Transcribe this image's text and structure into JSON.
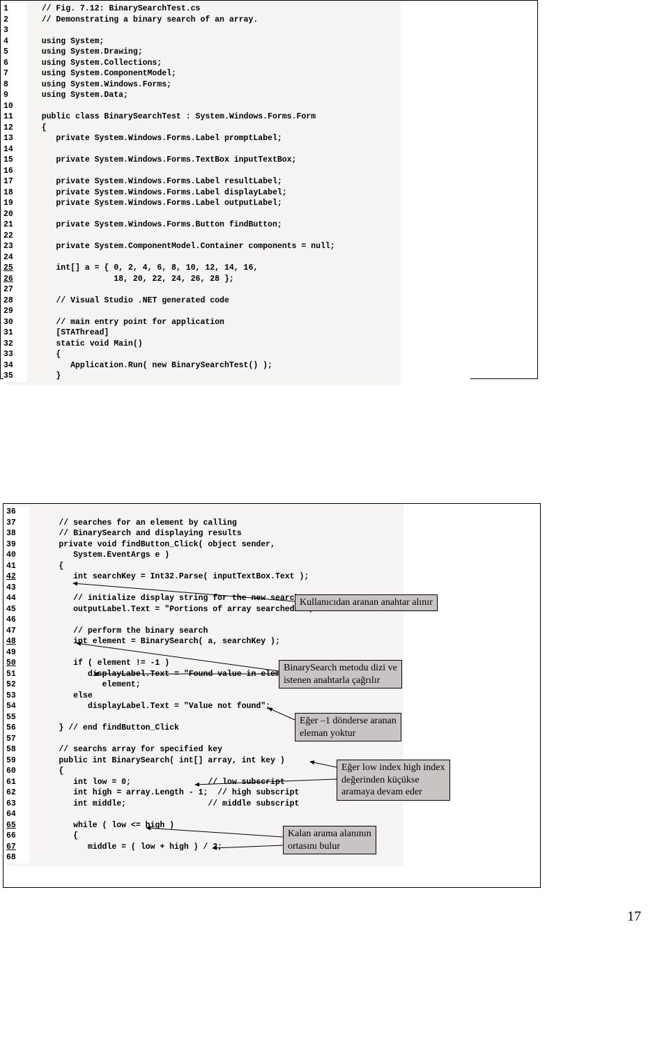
{
  "page_number": "17",
  "box1": {
    "lines": [
      {
        "n": "1",
        "u": false,
        "t": "// Fig. 7.12: BinarySearchTest.cs"
      },
      {
        "n": "2",
        "u": false,
        "t": "// Demonstrating a binary search of an array."
      },
      {
        "n": "3",
        "u": false,
        "t": ""
      },
      {
        "n": "4",
        "u": false,
        "t": "using System;"
      },
      {
        "n": "5",
        "u": false,
        "t": "using System.Drawing;"
      },
      {
        "n": "6",
        "u": false,
        "t": "using System.Collections;"
      },
      {
        "n": "7",
        "u": false,
        "t": "using System.ComponentModel;"
      },
      {
        "n": "8",
        "u": false,
        "t": "using System.Windows.Forms;"
      },
      {
        "n": "9",
        "u": false,
        "t": "using System.Data;"
      },
      {
        "n": "10",
        "u": false,
        "t": ""
      },
      {
        "n": "11",
        "u": false,
        "t": "public class BinarySearchTest : System.Windows.Forms.Form"
      },
      {
        "n": "12",
        "u": false,
        "t": "{"
      },
      {
        "n": "13",
        "u": false,
        "t": "   private System.Windows.Forms.Label promptLabel;"
      },
      {
        "n": "14",
        "u": false,
        "t": ""
      },
      {
        "n": "15",
        "u": false,
        "t": "   private System.Windows.Forms.TextBox inputTextBox;"
      },
      {
        "n": "16",
        "u": false,
        "t": ""
      },
      {
        "n": "17",
        "u": false,
        "t": "   private System.Windows.Forms.Label resultLabel;"
      },
      {
        "n": "18",
        "u": false,
        "t": "   private System.Windows.Forms.Label displayLabel;"
      },
      {
        "n": "19",
        "u": false,
        "t": "   private System.Windows.Forms.Label outputLabel;"
      },
      {
        "n": "20",
        "u": false,
        "t": ""
      },
      {
        "n": "21",
        "u": false,
        "t": "   private System.Windows.Forms.Button findButton;"
      },
      {
        "n": "22",
        "u": false,
        "t": ""
      },
      {
        "n": "23",
        "u": false,
        "t": "   private System.ComponentModel.Container components = null;"
      },
      {
        "n": "24",
        "u": false,
        "t": ""
      },
      {
        "n": "25",
        "u": true,
        "t": "   int[] a = { 0, 2, 4, 6, 8, 10, 12, 14, 16,"
      },
      {
        "n": "26",
        "u": true,
        "t": "               18, 20, 22, 24, 26, 28 };"
      },
      {
        "n": "27",
        "u": false,
        "t": ""
      },
      {
        "n": "28",
        "u": false,
        "t": "   // Visual Studio .NET generated code"
      },
      {
        "n": "29",
        "u": false,
        "t": ""
      },
      {
        "n": "30",
        "u": false,
        "t": "   // main entry point for application"
      },
      {
        "n": "31",
        "u": false,
        "t": "   [STAThread]"
      },
      {
        "n": "32",
        "u": false,
        "t": "   static void Main()"
      },
      {
        "n": "33",
        "u": false,
        "t": "   {"
      },
      {
        "n": "34",
        "u": false,
        "t": "      Application.Run( new BinarySearchTest() );"
      },
      {
        "n": "35",
        "u": false,
        "t": "   }"
      }
    ]
  },
  "box2": {
    "lines": [
      {
        "n": "36",
        "u": false,
        "t": ""
      },
      {
        "n": "37",
        "u": false,
        "t": "   // searches for an element by calling"
      },
      {
        "n": "38",
        "u": false,
        "t": "   // BinarySearch and displaying results"
      },
      {
        "n": "39",
        "u": false,
        "t": "   private void findButton_Click( object sender,"
      },
      {
        "n": "40",
        "u": false,
        "t": "      System.EventArgs e )"
      },
      {
        "n": "41",
        "u": false,
        "t": "   {"
      },
      {
        "n": "42",
        "u": true,
        "t": "      int searchKey = Int32.Parse( inputTextBox.Text );"
      },
      {
        "n": "43",
        "u": false,
        "t": ""
      },
      {
        "n": "44",
        "u": false,
        "t": "      // initialize display string for the new search"
      },
      {
        "n": "45",
        "u": false,
        "t": "      outputLabel.Text = \"Portions of array searched\\n\";"
      },
      {
        "n": "46",
        "u": false,
        "t": ""
      },
      {
        "n": "47",
        "u": false,
        "t": "      // perform the binary search"
      },
      {
        "n": "48",
        "u": true,
        "t": "      int element = BinarySearch( a, searchKey );"
      },
      {
        "n": "49",
        "u": false,
        "t": ""
      },
      {
        "n": "50",
        "u": true,
        "t": "      if ( element != -1 )"
      },
      {
        "n": "51",
        "u": false,
        "t": "         displayLabel.Text = \"Found value in element \" +"
      },
      {
        "n": "52",
        "u": false,
        "t": "            element;"
      },
      {
        "n": "53",
        "u": false,
        "t": "      else"
      },
      {
        "n": "54",
        "u": false,
        "t": "         displayLabel.Text = \"Value not found\";"
      },
      {
        "n": "55",
        "u": false,
        "t": ""
      },
      {
        "n": "56",
        "u": false,
        "t": "   } // end findButton_Click"
      },
      {
        "n": "57",
        "u": false,
        "t": ""
      },
      {
        "n": "58",
        "u": false,
        "t": "   // searchs array for specified key"
      },
      {
        "n": "59",
        "u": false,
        "t": "   public int BinarySearch( int[] array, int key )"
      },
      {
        "n": "60",
        "u": false,
        "t": "   {"
      },
      {
        "n": "61",
        "u": false,
        "t": "      int low = 0;                // low subscript"
      },
      {
        "n": "62",
        "u": false,
        "t": "      int high = array.Length - 1;  // high subscript"
      },
      {
        "n": "63",
        "u": false,
        "t": "      int middle;                 // middle subscript"
      },
      {
        "n": "64",
        "u": false,
        "t": ""
      },
      {
        "n": "65",
        "u": true,
        "t": "      while ( low <= high )"
      },
      {
        "n": "66",
        "u": false,
        "t": "      {"
      },
      {
        "n": "67",
        "u": true,
        "t": "         middle = ( low + high ) / 2;"
      },
      {
        "n": "68",
        "u": false,
        "t": ""
      }
    ],
    "annotations": {
      "a1": "Kullanıcıdan aranan anahtar alınır",
      "a2_l1": "BinarySearch metodu dizi ve",
      "a2_l2": "istenen anahtarla çağrılır",
      "a3_l1": "Eğer –1 dönderse aranan",
      "a3_l2": "eleman yoktur",
      "a4_l1": "Eğer low index high index",
      "a4_l2": "değerinden küçükse",
      "a4_l3": "aramaya devam eder",
      "a5_l1": "Kalan arama alanının",
      "a5_l2": "ortasını bulur"
    }
  }
}
